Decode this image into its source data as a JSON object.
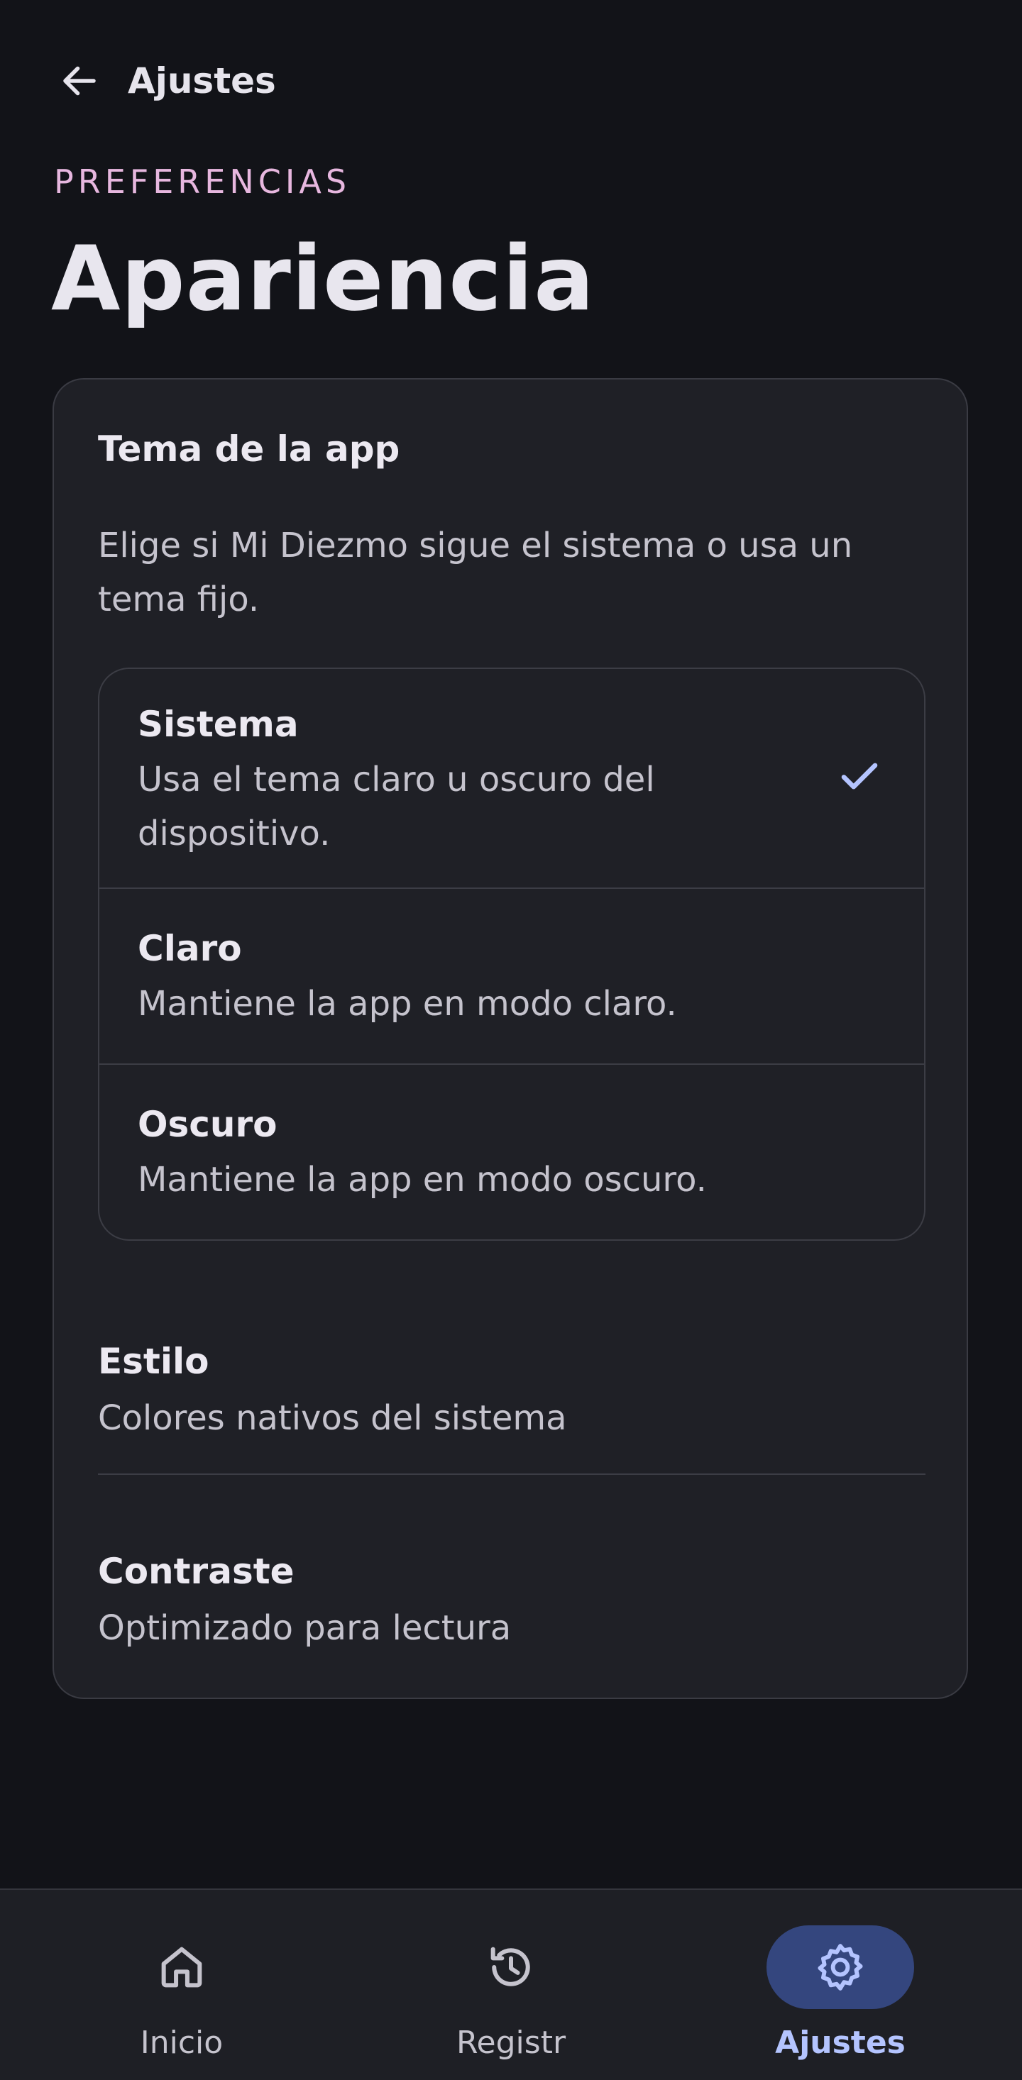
{
  "header": {
    "title": "Ajustes",
    "back_icon": "arrow-left-icon"
  },
  "section": {
    "eyebrow": "PREFERENCIAS",
    "title": "Apariencia"
  },
  "theme_card": {
    "heading": "Tema de la app",
    "description": "Elige si Mi Diezmo sigue el sistema o usa un tema fijo.",
    "options": [
      {
        "label": "Sistema",
        "description": "Usa el tema claro u oscuro del dispositivo.",
        "selected": true
      },
      {
        "label": "Claro",
        "description": "Mantiene la app en modo claro.",
        "selected": false
      },
      {
        "label": "Oscuro",
        "description": "Mantiene la app en modo oscuro.",
        "selected": false
      }
    ],
    "style": {
      "label": "Estilo",
      "value": "Colores nativos del sistema"
    },
    "contrast": {
      "label": "Contraste",
      "value": "Optimizado para lectura"
    }
  },
  "bottom_nav": {
    "items": [
      {
        "label": "Inicio",
        "icon": "home-icon",
        "active": false
      },
      {
        "label": "Registr",
        "icon": "history-icon",
        "active": false
      },
      {
        "label": "Ajustes",
        "icon": "gear-icon",
        "active": true
      }
    ]
  },
  "colors": {
    "background": "#121318",
    "card": "#1f2026",
    "accent": "#b4c4ff",
    "accent_container": "#34467e",
    "eyebrow": "#e7b7df"
  }
}
